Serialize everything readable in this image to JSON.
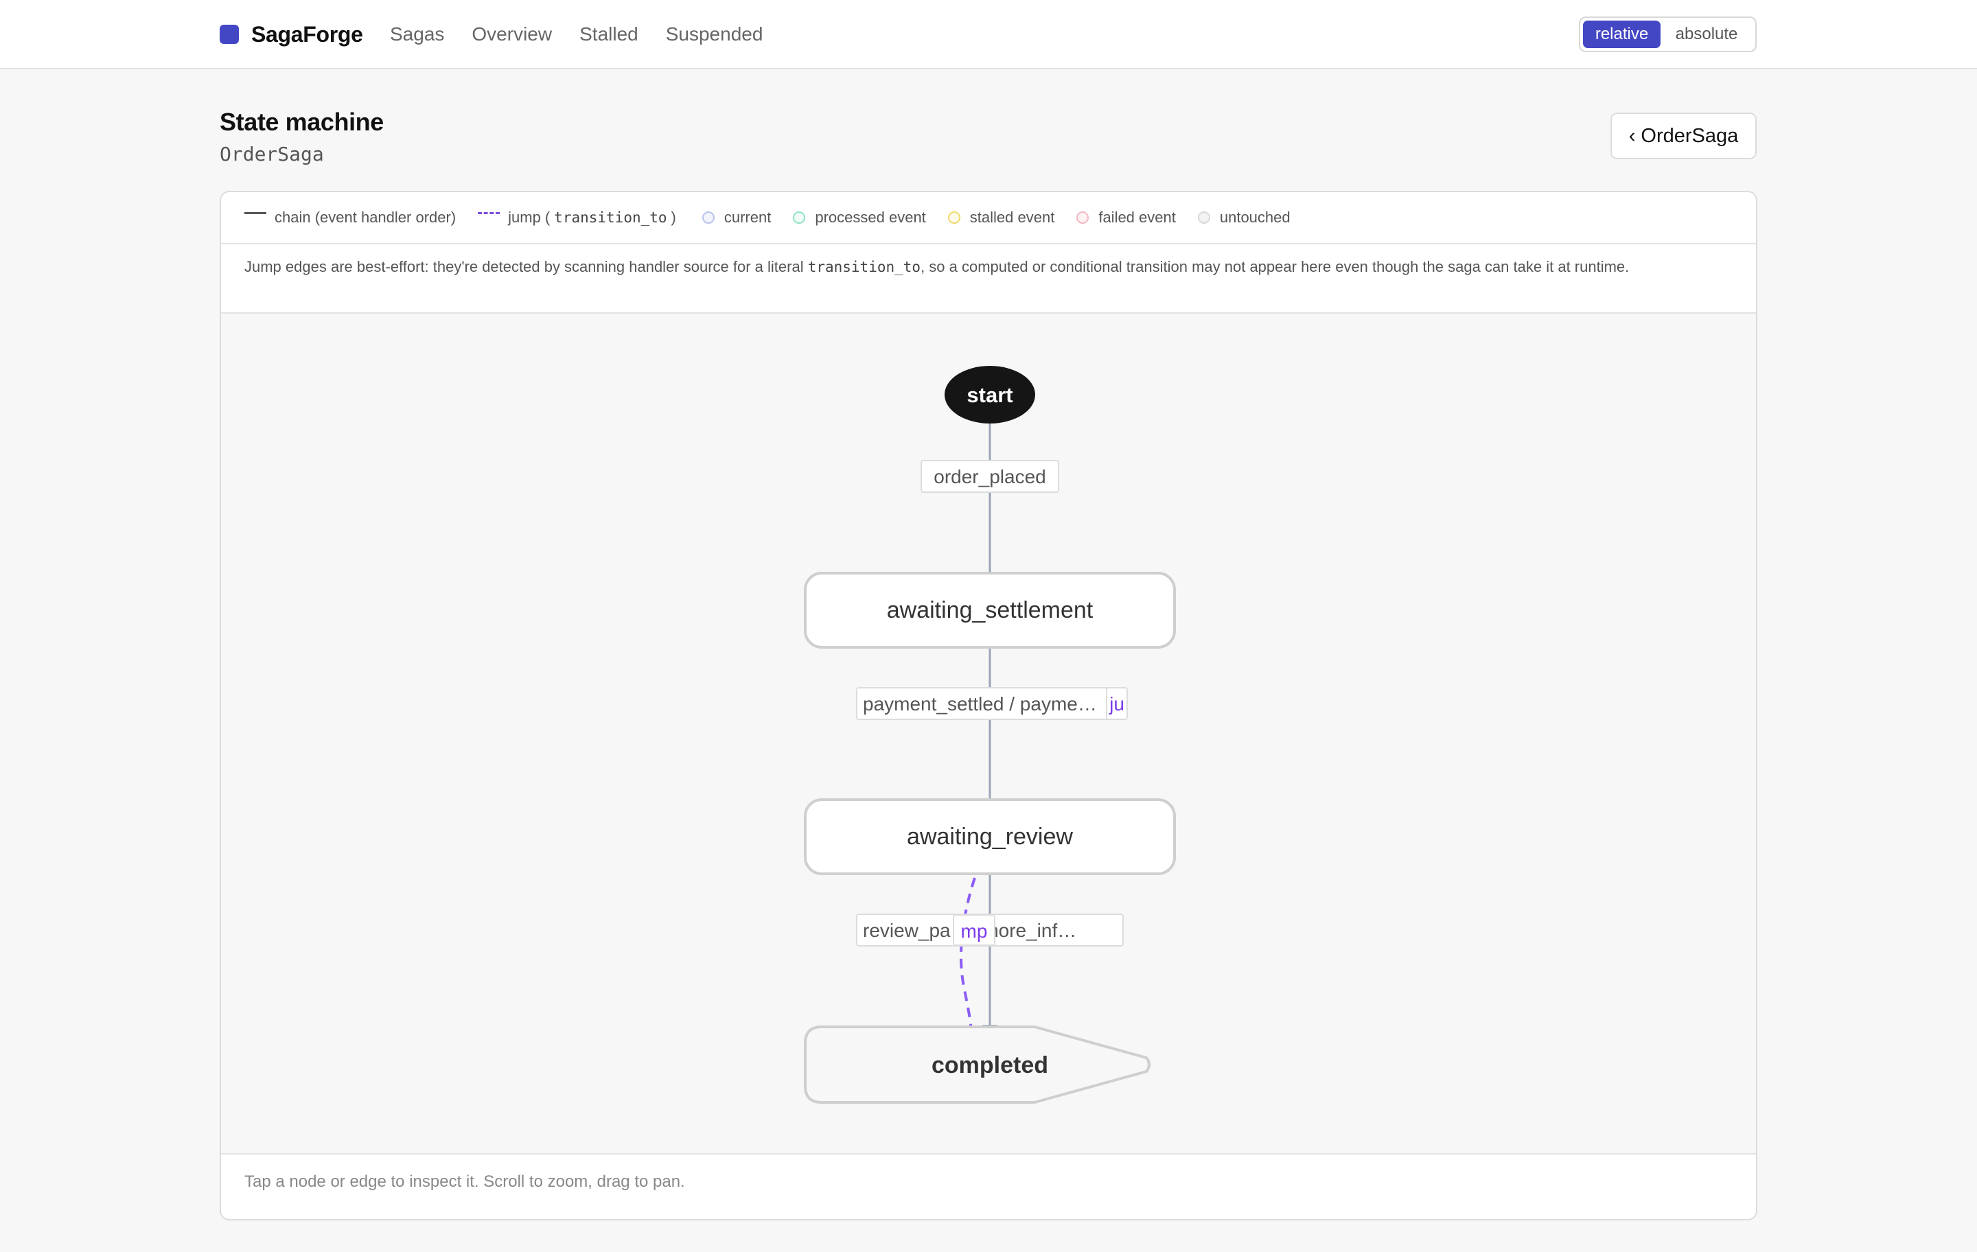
{
  "app": {
    "name": "SagaForge",
    "brand_color": "#4447c4"
  },
  "nav": {
    "items": [
      "Sagas",
      "Overview",
      "Stalled",
      "Suspended"
    ]
  },
  "time_toggle": {
    "options": [
      "relative",
      "absolute"
    ],
    "selected": "relative"
  },
  "header": {
    "title": "State machine",
    "subtitle": "OrderSaga",
    "back_label": "OrderSaga",
    "back_icon": "chevron-left-icon"
  },
  "legend": {
    "chain_label": "chain (event handler order)",
    "jump_label": "jump",
    "jump_code": "transition_to",
    "items": [
      {
        "label": "current",
        "color": "#b9c3ec"
      },
      {
        "label": "processed event",
        "color": "#8fe3c4"
      },
      {
        "label": "stalled event",
        "color": "#f2d86b"
      },
      {
        "label": "failed event",
        "color": "#f3b6c0"
      },
      {
        "label": "untouched",
        "color": "#d8d8d8"
      }
    ]
  },
  "note": {
    "before": "Jump edges are best-effort: they're detected by scanning handler source for a literal ",
    "code": "transition_to",
    "after": ", so a computed or conditional transition may not appear here even though the saga can take it at runtime."
  },
  "graph": {
    "colors": {
      "chain": "#9aa4b6",
      "jump": "#8b5cf6",
      "node_border": "#cfcfcf"
    },
    "nodes": [
      {
        "id": "start",
        "label": "start",
        "kind": "initial"
      },
      {
        "id": "awaiting_settlement",
        "label": "awaiting_settlement",
        "kind": "state"
      },
      {
        "id": "awaiting_review",
        "label": "awaiting_review",
        "kind": "state"
      },
      {
        "id": "completed",
        "label": "completed",
        "kind": "terminal"
      }
    ],
    "edges": [
      {
        "from": "start",
        "to": "awaiting_settlement",
        "type": "chain",
        "label": "order_placed"
      },
      {
        "from": "awaiting_settlement",
        "to": "awaiting_review",
        "type": "chain",
        "label": "payment_settled / payme…"
      },
      {
        "from": "awaiting_settlement",
        "to": "awaiting_review",
        "type": "jump",
        "label": "ju"
      },
      {
        "from": "awaiting_review",
        "to": "completed",
        "type": "chain",
        "label": "review_pa d / more_inf…"
      },
      {
        "from": "awaiting_review",
        "to": "completed",
        "type": "jump",
        "label": "mp"
      }
    ]
  },
  "footer": {
    "hint": "Tap a node or edge to inspect it. Scroll to zoom, drag to pan."
  }
}
